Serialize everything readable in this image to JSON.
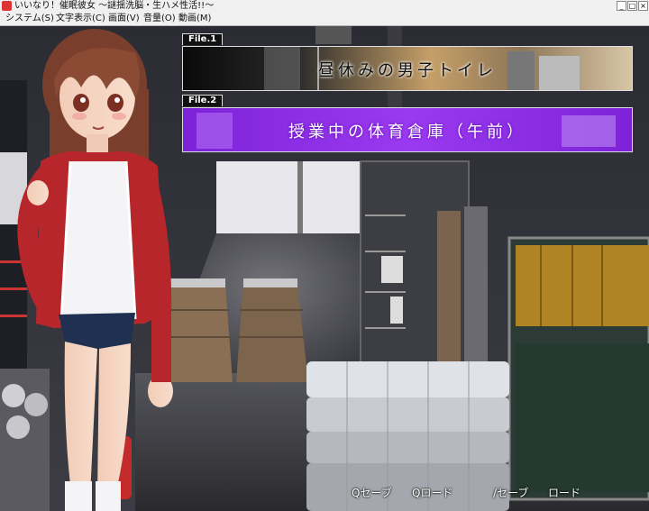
{
  "window": {
    "title": "いいなり！催眠彼女 ～謎揺洗脳・生ハメ性活!!～"
  },
  "menu": {
    "items": [
      "システム(S)",
      "文字表示(C)",
      "画面(V)",
      "音量(O)",
      "動画(M)"
    ]
  },
  "files": [
    {
      "tab": "File.1",
      "title": "昼休みの男子トイレ"
    },
    {
      "tab": "File.2",
      "title": "授業中の体育倉庫（午前）"
    }
  ],
  "quick_menu": {
    "qsave": "Qセーブ",
    "qload": "Qロード",
    "save": "/セーブ",
    "load": "ロード"
  },
  "colors": {
    "file2_accent": "#8b2be0",
    "file1_accent": "#d4b27a"
  }
}
